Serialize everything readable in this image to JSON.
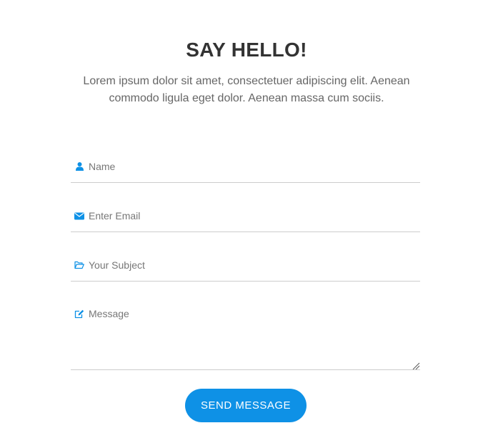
{
  "header": {
    "title": "SAY HELLO!",
    "intro": "Lorem ipsum dolor sit amet, consectetuer adipiscing elit. Aenean commodo ligula eget dolor. Aenean massa cum sociis."
  },
  "form": {
    "name": {
      "placeholder": "Name",
      "value": "",
      "icon": "user-icon"
    },
    "email": {
      "placeholder": "Enter Email",
      "value": "",
      "icon": "envelope-icon"
    },
    "subject": {
      "placeholder": "Your Subject",
      "value": "",
      "icon": "folder-open-icon"
    },
    "message": {
      "placeholder": "Message",
      "value": "",
      "icon": "edit-icon"
    },
    "submit_label": "SEND MESSAGE"
  },
  "colors": {
    "accent": "#0e91e6",
    "title": "#333333",
    "text": "#666666",
    "divider": "#cccccc"
  }
}
